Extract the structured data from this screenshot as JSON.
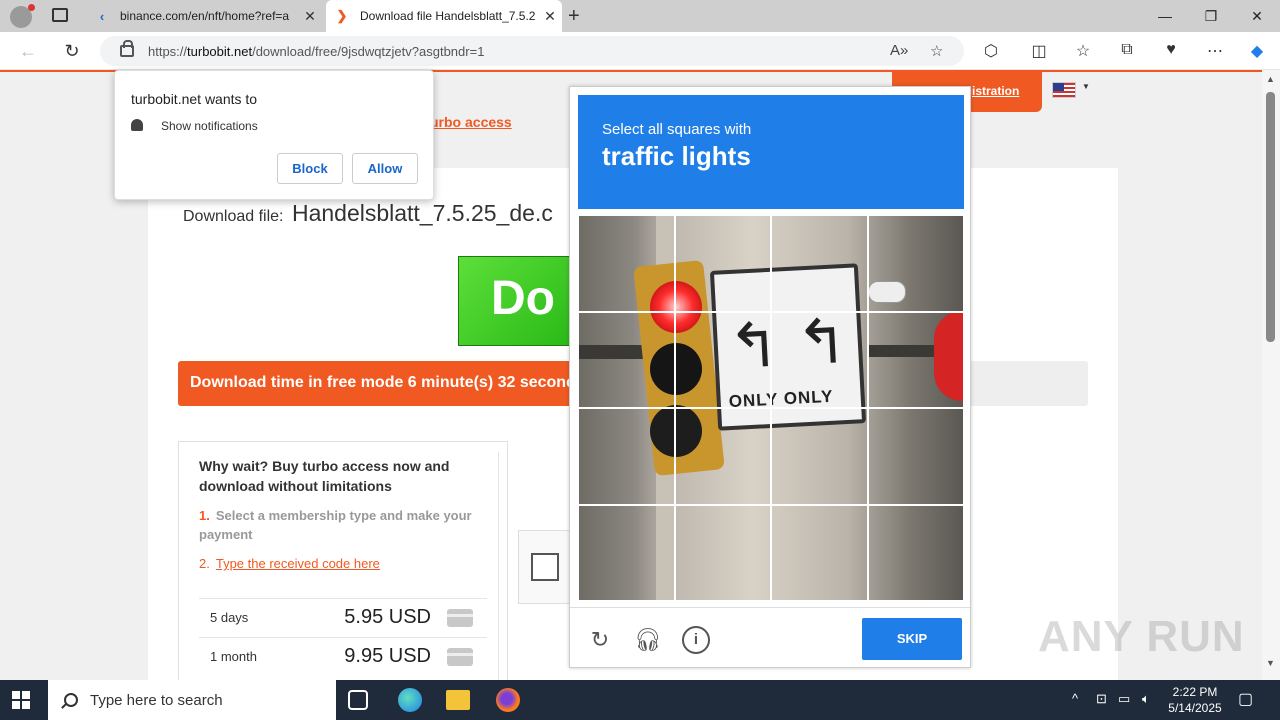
{
  "browser": {
    "tabs": [
      {
        "title": "binance.com/en/nft/home?ref=a",
        "active": false
      },
      {
        "title": "Download file Handelsblatt_7.5.2",
        "active": true
      }
    ],
    "address": {
      "prefix": "https://",
      "domain": "turbobit.net",
      "path": "/download/free/9jsdwqtzjetv?asgtbndr=1"
    },
    "window_controls": {
      "minimize": "—",
      "restore": "❐",
      "close": "✕"
    }
  },
  "notification": {
    "heading": "turbobit.net wants to",
    "permission": "Show notifications",
    "block_label": "Block",
    "allow_label": "Allow"
  },
  "page": {
    "registration_label": "egistration",
    "turbo_link": "urbo access",
    "download_file_label": "Download file:",
    "file_name": "Handelsblatt_7.5.25_de.c",
    "banner_text": "Do",
    "time_notice": "Download time in free mode 6 minute(s) 32 seconds",
    "why_wait": "Why wait? Buy turbo access now and download without limitations",
    "step1_num": "1.",
    "step1": "Select a membership type and make your payment",
    "step2_num": "2.",
    "step2": "Type the received code here",
    "prices": [
      {
        "period": "5 days",
        "price": "5.95 USD"
      },
      {
        "period": "1 month",
        "price": "9.95 USD"
      }
    ]
  },
  "captcha": {
    "instruction": "Select all squares with",
    "target": "traffic lights",
    "sign_text": "ONLY ONLY",
    "skip_label": "SKIP",
    "icons": [
      "refresh-icon",
      "headphones-icon",
      "info-icon"
    ]
  },
  "watermark": "ANY RUN",
  "taskbar": {
    "search_placeholder": "Type here to search",
    "time": "2:22 PM",
    "date": "5/14/2025"
  }
}
